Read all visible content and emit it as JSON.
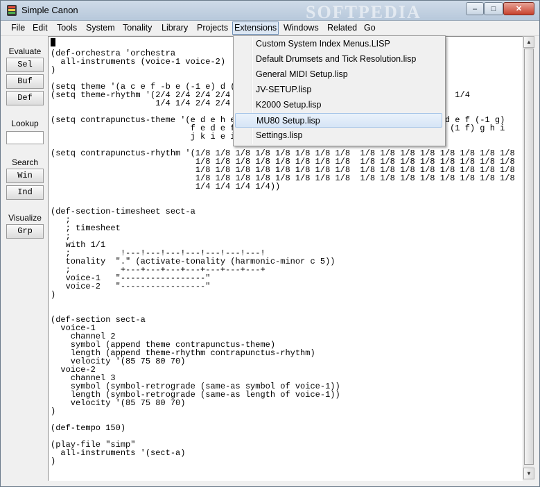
{
  "window": {
    "title": "Simple Canon",
    "watermark": "SOFTPEDIA",
    "controls": {
      "minimize": "–",
      "maximize": "□",
      "close": "✕"
    }
  },
  "menubar": [
    "File",
    "Edit",
    "Tools",
    "System",
    "Tonality",
    "Library",
    "Projects",
    "Extensions",
    "Windows",
    "Related",
    "Go"
  ],
  "sidebar": {
    "evaluate_label": "Evaluate",
    "sel": "Sel",
    "buf": "Buf",
    "def": "Def",
    "lookup_label": "Lookup",
    "lookup_value": "",
    "search_label": "Search",
    "win": "Win",
    "ind": "Ind",
    "visualize_label": "Visualize",
    "grp": "Grp"
  },
  "dropdown": {
    "items": [
      "Custom System Index Menus.LISP",
      "Default Drumsets and Tick Resolution.lisp",
      "General MIDI Setup.lisp",
      "JV-SETUP.lisp",
      "K2000 Setup.lisp",
      "MU80 Setup.lisp",
      "Settings.lisp"
    ],
    "highlighted": "MU80 Setup.lisp"
  },
  "editor": {
    "code": "(def-orchestra 'orchestra\n  all-instruments (voice-1 voice-2)\n)\n\n(setq theme '(a c e f -b e (-1 e) d (\n(setq theme-rhythm '(2/4 2/4 2/4 2/4                                             1/4\n                     1/4 1/4 2/4 2/4 2\n\n(setq contrapunctus-theme '(e d e h e                                          d e f (-1 g)\n                            f e d e f                                         g (1 f) g h i\n                            j k i e i\n\n(setq contrapunctus-rhythm '(1/8 1/8 1/8 1/8 1/8 1/8 1/8 1/8  1/8 1/8 1/8 1/8 1/8 1/8 1/8 1/8\n                             1/8 1/8 1/8 1/8 1/8 1/8 1/8 1/8  1/8 1/8 1/8 1/8 1/8 1/8 1/8 1/8\n                             1/8 1/8 1/8 1/8 1/8 1/8 1/8 1/8  1/8 1/8 1/8 1/8 1/8 1/8 1/8 1/8\n                             1/8 1/8 1/8 1/8 1/8 1/8 1/8 1/8  1/8 1/8 1/8 1/8 1/8 1/8 1/8 1/8\n                             1/4 1/4 1/4 1/4))\n\n\n(def-section-timesheet sect-a\n   ;\n   ; timesheet\n   ;\n   with 1/1\n   ;          !---!---!---!---!---!---!---!\n   tonality  \".\" (activate-tonality (harmonic-minor c 5))\n   ;          +---+---+---+---+---+---+---+\n   voice-1   \"-----------------\"\n   voice-2   \"-----------------\"\n)\n\n\n(def-section sect-a\n  voice-1\n    channel 2\n    symbol (append theme contrapunctus-theme)\n    length (append theme-rhythm contrapunctus-rhythm)\n    velocity '(85 75 80 70)\n  voice-2\n    channel 3\n    symbol (symbol-retrograde (same-as symbol of voice-1))\n    length (symbol-retrograde (same-as length of voice-1))\n    velocity '(85 75 80 70)\n)\n\n(def-tempo 150)\n\n(play-file \"simp\"\n  all-instruments '(sect-a)\n)"
  },
  "scrollbar": {
    "up": "▲",
    "down": "▼"
  }
}
